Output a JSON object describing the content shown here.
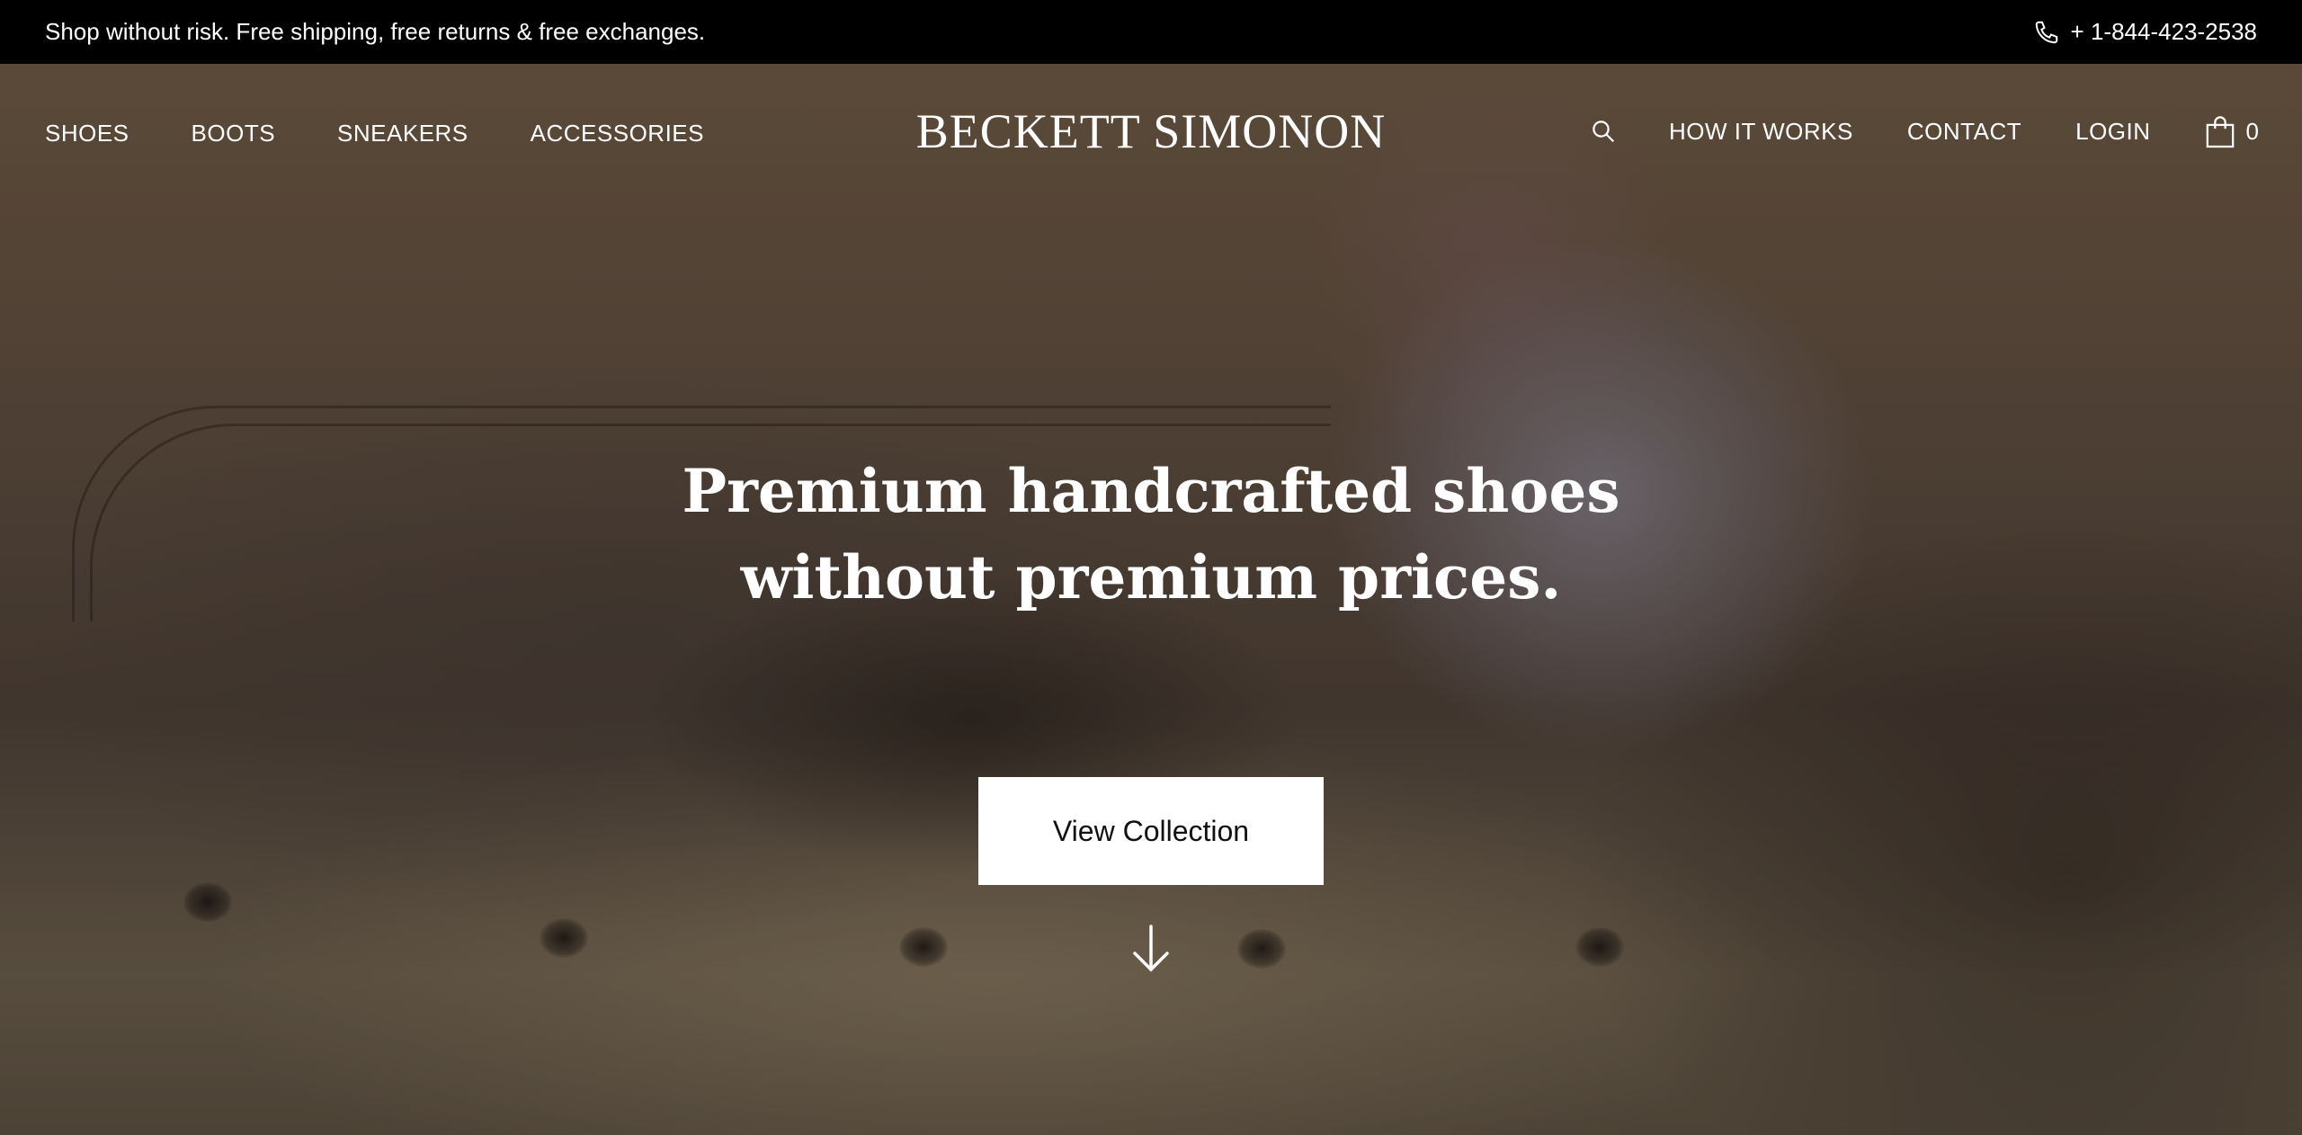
{
  "announcement": {
    "message": "Shop without risk. Free shipping, free returns & free exchanges.",
    "phone": "+ 1-844-423-2538"
  },
  "nav": {
    "left": [
      "SHOES",
      "BOOTS",
      "SNEAKERS",
      "ACCESSORIES"
    ],
    "logo": "BECKETT SIMONON",
    "right": [
      "HOW IT WORKS",
      "CONTACT",
      "LOGIN"
    ],
    "cart_count": "0"
  },
  "hero": {
    "title_line1": "Premium handcrafted shoes",
    "title_line2": "without premium prices.",
    "cta_label": "View Collection"
  },
  "icons": [
    "phone-icon",
    "search-icon",
    "shopping-bag-icon",
    "arrow-down-icon"
  ],
  "colors": {
    "topbar_bg": "#000000",
    "text": "#ffffff",
    "cta_bg": "#ffffff",
    "cta_text": "#111111"
  }
}
